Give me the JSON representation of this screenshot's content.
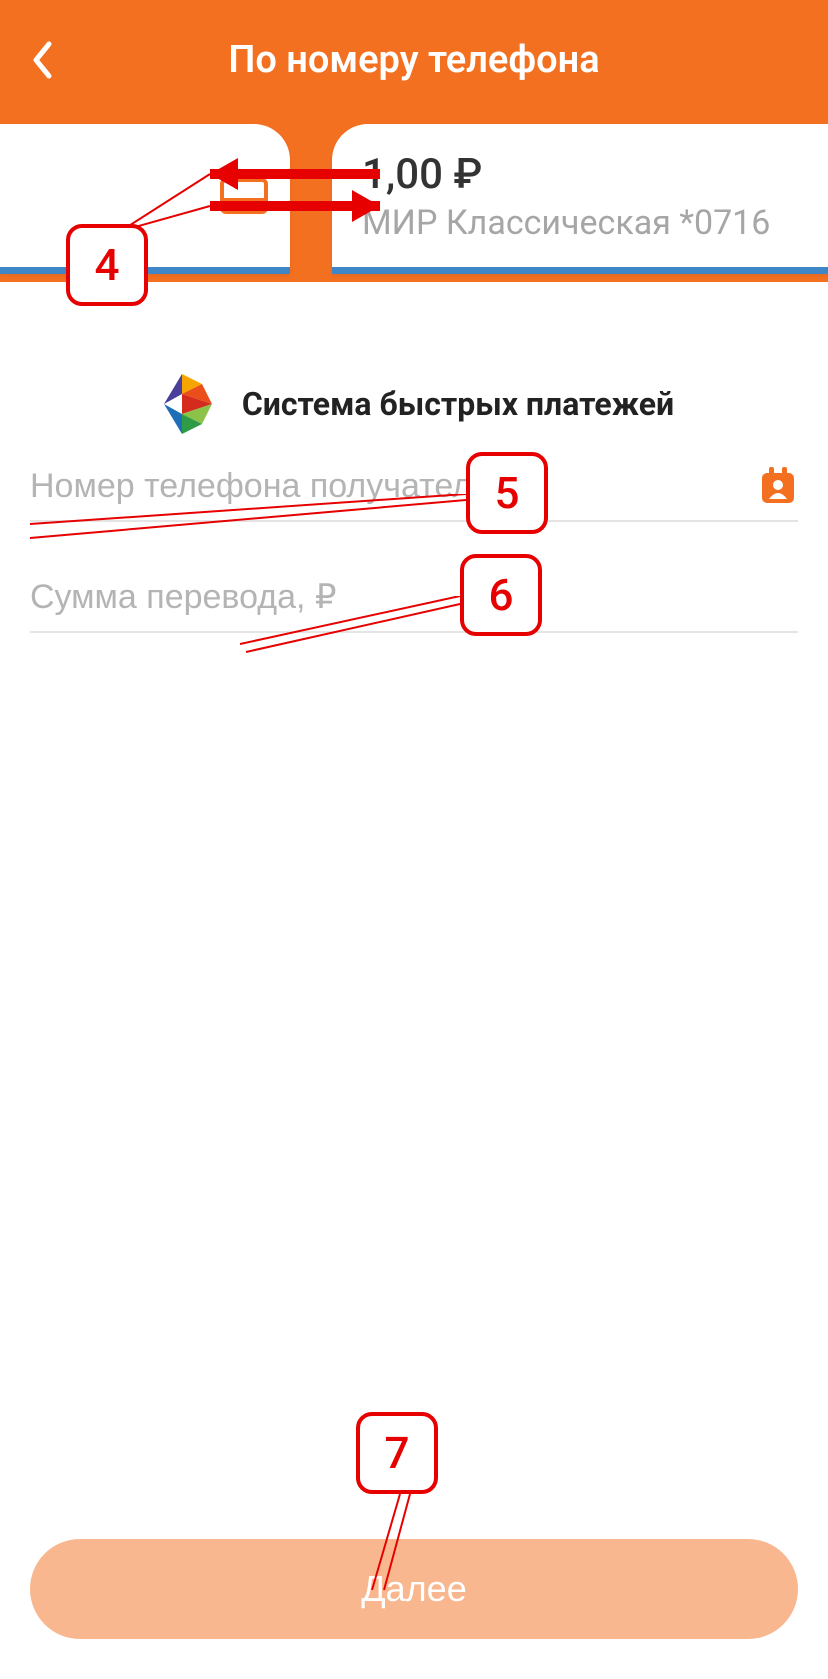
{
  "header": {
    "title": "По номеру телефона"
  },
  "card": {
    "balance": "1,00 ₽",
    "name": "МИР Классическая *0716"
  },
  "sbp": {
    "label": "Система быстрых платежей"
  },
  "fields": {
    "phone_placeholder": "Номер телефона получателя",
    "amount_placeholder": "Сумма перевода, ₽"
  },
  "actions": {
    "next": "Далее"
  },
  "annotations": {
    "a4": "4",
    "a5": "5",
    "a6": "6",
    "a7": "7"
  }
}
